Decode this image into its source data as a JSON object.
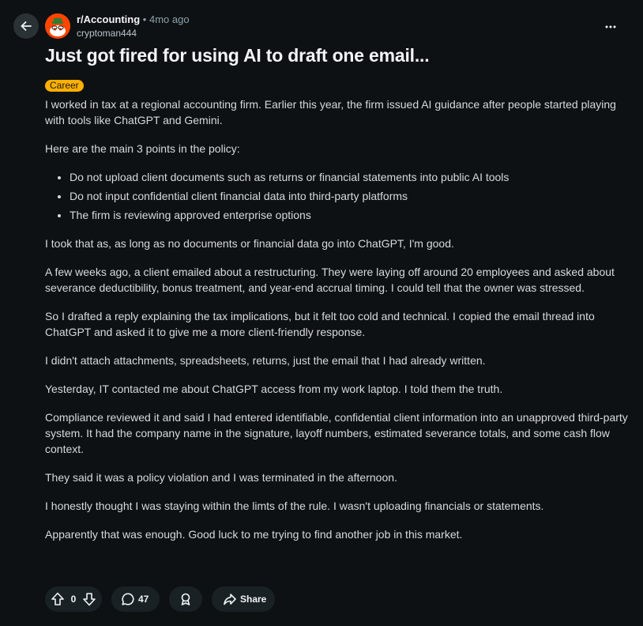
{
  "post": {
    "subreddit": "r/Accounting",
    "separator": "•",
    "time": "4mo ago",
    "author": "cryptoman444",
    "title": "Just got fired for using AI to draft one email...",
    "flair": "Career",
    "flair_color": "#ffb000",
    "paragraphs_before_list": [
      "I worked in tax at a regional accounting firm. Earlier this year, the firm issued AI guidance after people started playing with tools like ChatGPT and Gemini.",
      "Here are the main 3 points in the policy:"
    ],
    "list": [
      "Do not upload client documents such as returns or financial statements into public AI tools",
      "Do not input confidential client financial data into third-party platforms",
      "The firm is reviewing approved enterprise options"
    ],
    "paragraphs_after_list": [
      "I took that as, as long as no documents or financial data go into ChatGPT, I'm good.",
      "A few weeks ago, a client emailed about a restructuring. They were laying off around 20 employees and asked about severance deductibility, bonus treatment, and year-end accrual timing. I could tell that the owner was stressed.",
      "So I drafted a reply explaining the tax implications, but it felt too cold and technical. I copied the email thread into ChatGPT and asked it to give me a more client-friendly response.",
      "I didn't attach attachments, spreadsheets, returns, just the email that I had already written.",
      "Yesterday, IT contacted me about ChatGPT access from my work laptop. I told them the truth.",
      "Compliance reviewed it and said I had entered identifiable, confidential client information into an unapproved third-party system. It had the company name in the signature, layoff numbers, estimated severance totals, and some cash flow context.",
      "They said it was a policy violation and I was terminated in the afternoon.",
      "I honestly thought I was staying within the limts of the rule. I wasn't uploading financials or statements.",
      "Apparently that was enough. Good luck to me trying to find another job in this market."
    ]
  },
  "actions": {
    "score": "0",
    "comments": "47",
    "share_label": "Share"
  },
  "icons": {
    "back": "arrow-left-icon",
    "more": "more-horizontal-icon",
    "upvote": "upvote-arrow-icon",
    "downvote": "downvote-arrow-icon",
    "comment": "comment-bubble-icon",
    "award": "award-icon",
    "share": "share-arrow-icon"
  }
}
